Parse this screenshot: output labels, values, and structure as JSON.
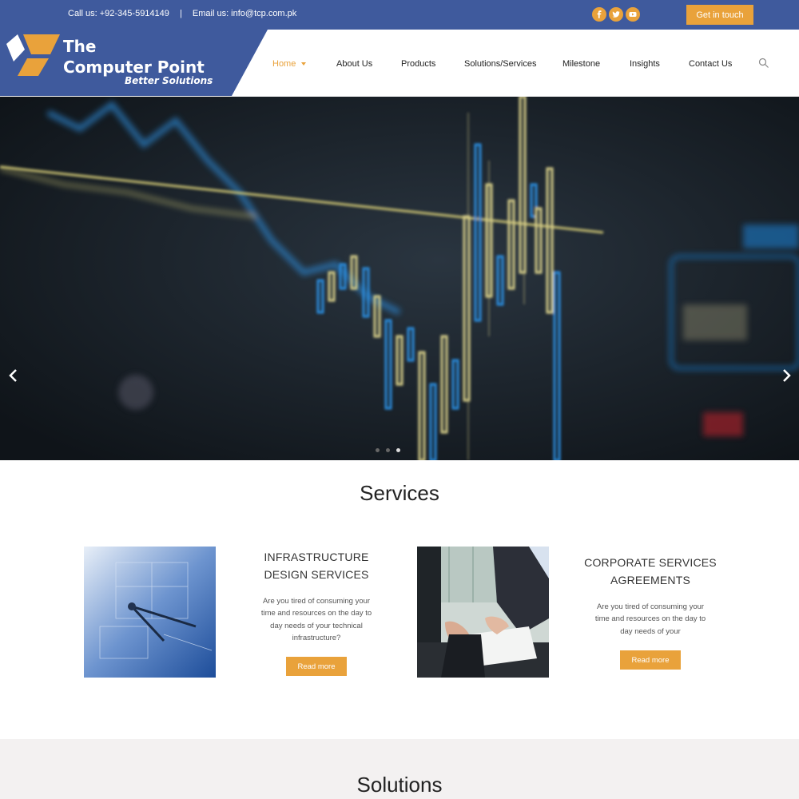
{
  "topbar": {
    "phone": "Call us: +92-345-5914149",
    "separator": "|",
    "email": "Email us: info@tcp.com.pk",
    "cta_label": "Get in touch",
    "social_icons": [
      "facebook-icon",
      "twitter-icon",
      "youtube-icon"
    ],
    "accent": "#e9a23b",
    "background": "#3f5a9d"
  },
  "logo": {
    "line1": "The",
    "line2": "Computer Point",
    "tagline": "Better Solutions"
  },
  "nav": {
    "items": [
      "Home",
      "About Us",
      "Products",
      "Solutions/Services",
      "Milestone",
      "Insights",
      "Contact Us"
    ],
    "active": "Home"
  },
  "hero": {
    "slides_count": 3,
    "active_slide": 3
  },
  "services": {
    "title": "Services",
    "cards": [
      {
        "title_line1": "INFRASTRUCTURE",
        "title_line2": "DESIGN SERVICES",
        "text_lines": [
          "Are you tired of consuming your",
          "time and resources on the day to",
          "day needs of your technical",
          "infrastructure?"
        ],
        "button": "Read more"
      },
      {
        "title_line1": "CORPORATE SERVICES",
        "title_line2": "AGREEMENTS",
        "text_lines": [
          "Are you tired of consuming your",
          "time and resources on the day to",
          "day needs of your"
        ],
        "button": "Read more"
      }
    ]
  },
  "solutions": {
    "title": "Solutions"
  }
}
